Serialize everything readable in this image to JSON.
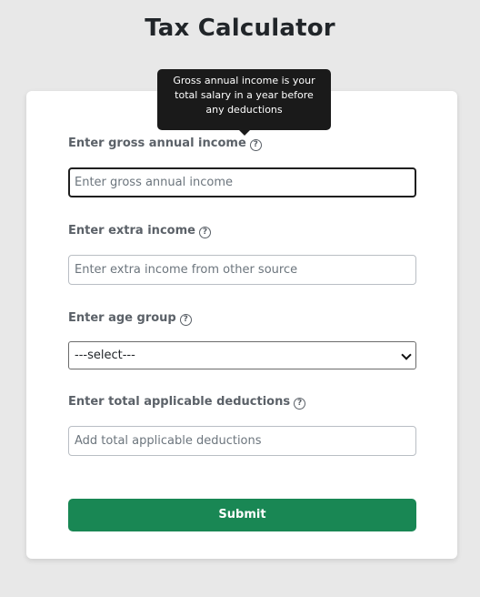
{
  "page": {
    "title": "Tax Calculator"
  },
  "tooltip": {
    "lines": [
      "Gross annual income is your",
      "total salary in a year before",
      "any deductions"
    ]
  },
  "form": {
    "gross_income": {
      "label": "Enter gross annual income",
      "placeholder": "Enter gross annual income",
      "value": ""
    },
    "extra_income": {
      "label": "Enter extra income",
      "placeholder": "Enter extra income from other source",
      "value": ""
    },
    "age_group": {
      "label": "Enter age group",
      "selected": "---select---"
    },
    "deductions": {
      "label": "Enter total applicable deductions",
      "placeholder": "Add total applicable deductions",
      "value": ""
    },
    "submit_label": "Submit",
    "help_glyph": "?"
  },
  "colors": {
    "background": "#e8e8e8",
    "card": "#ffffff",
    "submit": "#198754",
    "tooltip": "#1a1a1a",
    "label": "#5b6168"
  },
  "icons": {
    "help": "help-circle-icon",
    "dropdown": "chevron-down-icon"
  }
}
